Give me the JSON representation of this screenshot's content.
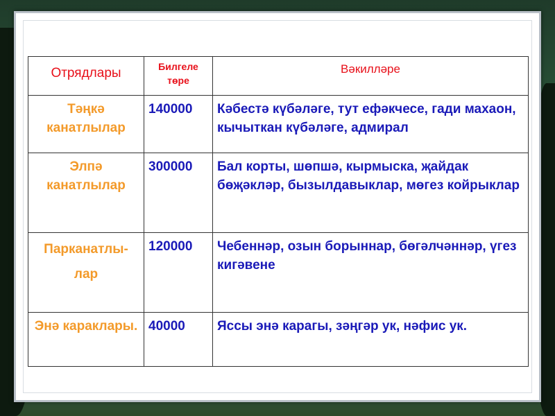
{
  "table": {
    "headers": [
      "Отрядлары",
      "Билгеле төре",
      "Вәкилләре"
    ],
    "rows": [
      {
        "order": "Тәңкә канатлылар",
        "count": "140000",
        "examples": "Кәбестә күбәләге, тут ефәкчесе, гади махаон, кычыткан күбәләге, адмирал"
      },
      {
        "order": "Элпә канатлылар",
        "count": "300000",
        "examples": "Бал корты, шөпшә, кырмыска, җайдак бөҗәкләр, бызылдавыклар, мөгез койрыклар"
      },
      {
        "order": "Парканатлы-лар",
        "count": "120000",
        "examples": "Чебеннәр, озын борыннар, бөгәлчәннәр, үгез кигәвене"
      },
      {
        "order": "Энә караклары.",
        "count": "40000",
        "examples": "Яссы энә карагы, зәңгәр ук, нәфис ук."
      }
    ]
  }
}
